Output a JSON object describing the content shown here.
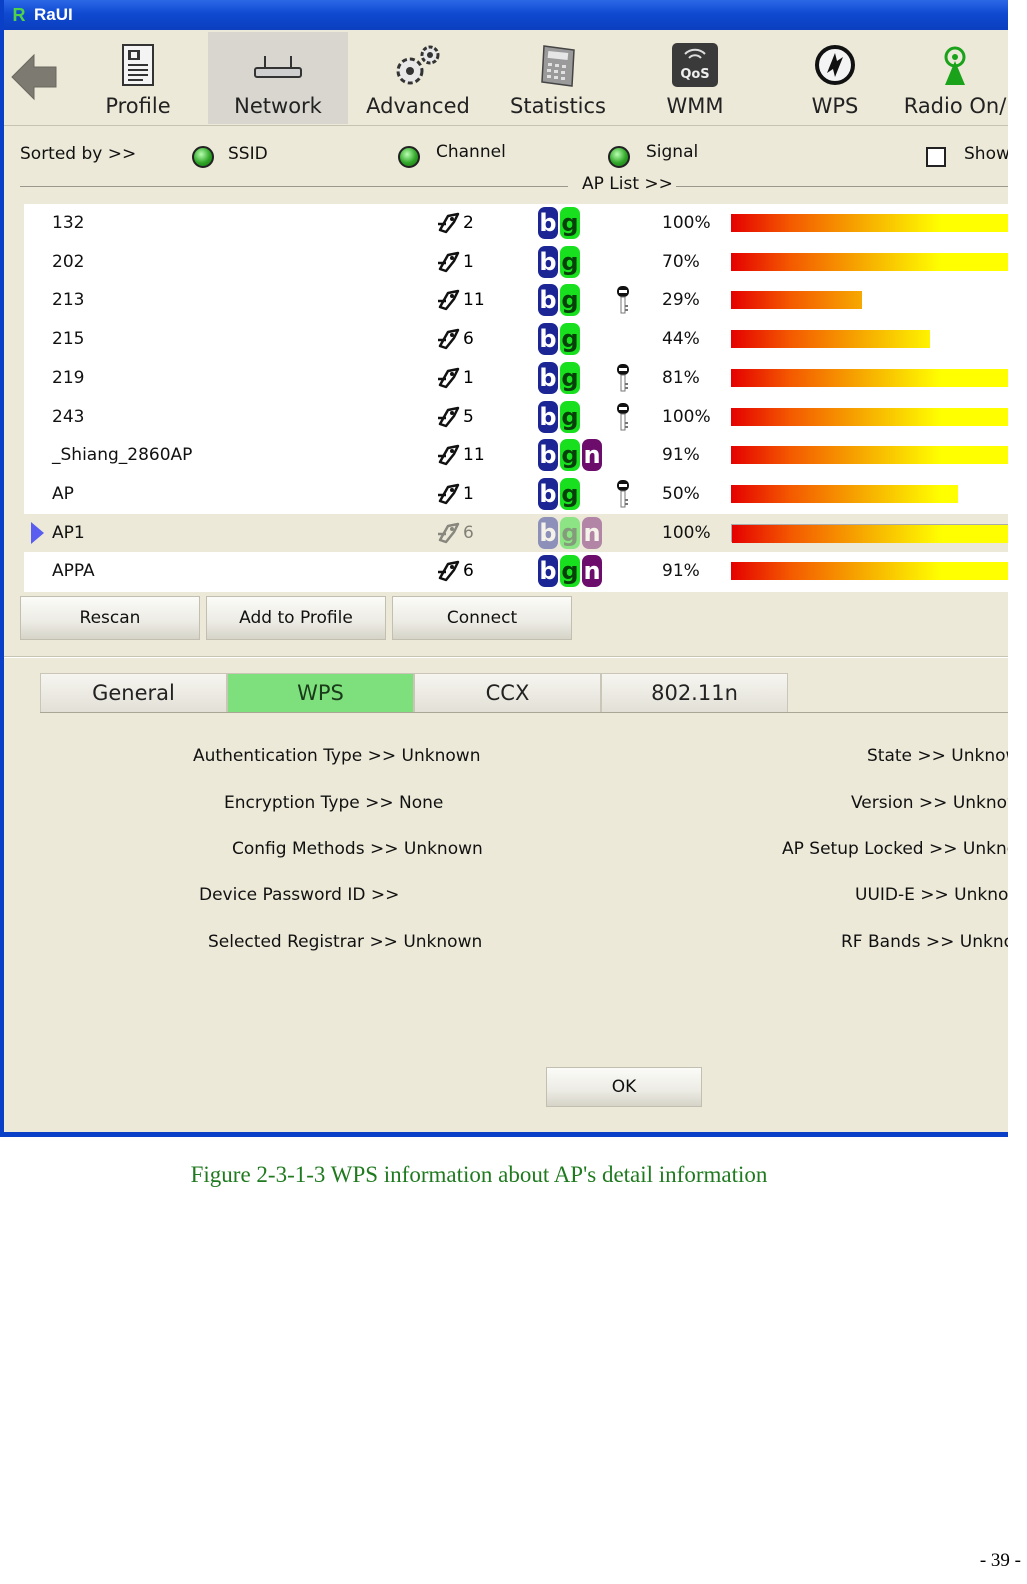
{
  "window": {
    "title": "RaUI"
  },
  "toolbar": {
    "items": [
      {
        "label": "Profile",
        "icon": "profile-icon"
      },
      {
        "label": "Network",
        "icon": "network-icon"
      },
      {
        "label": "Advanced",
        "icon": "advanced-gears-icon"
      },
      {
        "label": "Statistics",
        "icon": "statistics-calculator-icon"
      },
      {
        "label": "WMM",
        "icon": "qos-icon"
      },
      {
        "label": "WPS",
        "icon": "wps-icon"
      },
      {
        "label": "Radio On/",
        "icon": "radio-antenna-icon"
      }
    ],
    "active": "Network"
  },
  "sort": {
    "label": "Sorted by >>",
    "options": [
      "SSID",
      "Channel",
      "Signal"
    ],
    "show_label": "Show"
  },
  "ap_list": {
    "label": "AP List >>",
    "rows": [
      {
        "ssid": "132",
        "channel": "2",
        "modes": [
          "b",
          "g"
        ],
        "secured": false,
        "signal": "100%",
        "level": 100
      },
      {
        "ssid": "202",
        "channel": "1",
        "modes": [
          "b",
          "g"
        ],
        "secured": false,
        "signal": "70%",
        "level": 100
      },
      {
        "ssid": "213",
        "channel": "11",
        "modes": [
          "b",
          "g"
        ],
        "secured": true,
        "signal": "29%",
        "level": 46
      },
      {
        "ssid": "215",
        "channel": "6",
        "modes": [
          "b",
          "g"
        ],
        "secured": false,
        "signal": "44%",
        "level": 70
      },
      {
        "ssid": "219",
        "channel": "1",
        "modes": [
          "b",
          "g"
        ],
        "secured": true,
        "signal": "81%",
        "level": 100
      },
      {
        "ssid": "243",
        "channel": "5",
        "modes": [
          "b",
          "g"
        ],
        "secured": true,
        "signal": "100%",
        "level": 100
      },
      {
        "ssid": "_Shiang_2860AP",
        "channel": "11",
        "modes": [
          "b",
          "g",
          "n"
        ],
        "secured": false,
        "signal": "91%",
        "level": 100
      },
      {
        "ssid": "AP",
        "channel": "1",
        "modes": [
          "b",
          "g"
        ],
        "secured": true,
        "signal": "50%",
        "level": 80
      },
      {
        "ssid": "AP1",
        "channel": "6",
        "modes": [
          "b",
          "g",
          "n"
        ],
        "secured": false,
        "signal": "100%",
        "level": 100,
        "selected": true
      },
      {
        "ssid": "APPA",
        "channel": "6",
        "modes": [
          "b",
          "g",
          "n"
        ],
        "secured": false,
        "signal": "91%",
        "level": 100
      }
    ]
  },
  "buttons": {
    "rescan": "Rescan",
    "add_to_profile": "Add to Profile",
    "connect": "Connect",
    "ok": "OK"
  },
  "tabs": {
    "items": [
      "General",
      "WPS",
      "CCX",
      "802.11n"
    ],
    "active": "WPS"
  },
  "wps_info": {
    "left": [
      {
        "label": "Authentication Type >>",
        "value": "Unknown"
      },
      {
        "label": "Encryption Type >>",
        "value": "None"
      },
      {
        "label": "Config Methods >>",
        "value": "Unknown"
      },
      {
        "label": "Device Password ID >>",
        "value": ""
      },
      {
        "label": "Selected Registrar >>",
        "value": "Unknown"
      }
    ],
    "right": [
      {
        "label": "State >>",
        "value": "Unknown"
      },
      {
        "label": "Version >>",
        "value": "Unknown"
      },
      {
        "label": "AP Setup Locked >>",
        "value": "Unknown"
      },
      {
        "label": "UUID-E >>",
        "value": "Unknown"
      },
      {
        "label": "RF Bands >>",
        "value": "Unknown"
      }
    ]
  },
  "caption": "Figure 2-3-1-3 WPS information about AP's detail information",
  "page_number": "- 39 -"
}
